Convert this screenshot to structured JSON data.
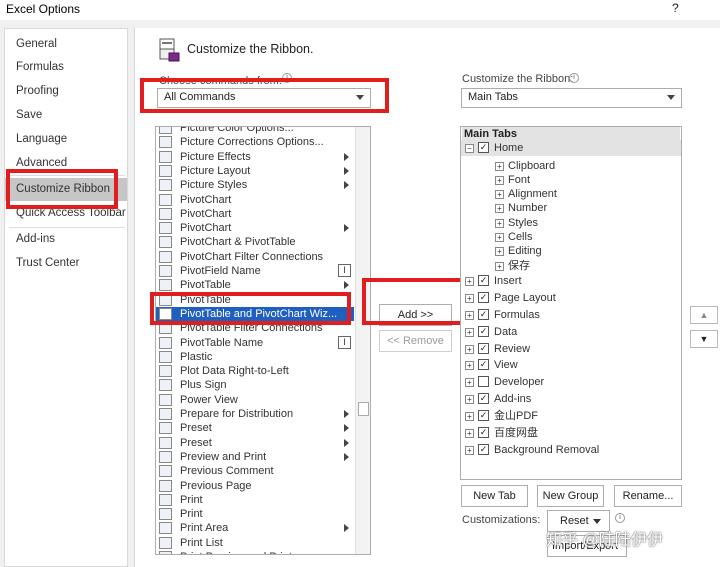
{
  "window": {
    "title": "Excel Options",
    "help": "?"
  },
  "nav": {
    "items": [
      "General",
      "Formulas",
      "Proofing",
      "Save",
      "Language",
      "Advanced",
      "Customize Ribbon",
      "Quick Access Toolbar",
      "Add-ins",
      "Trust Center"
    ],
    "selected": "Customize Ribbon"
  },
  "header": {
    "title": "Customize the Ribbon."
  },
  "left": {
    "choose_label": "Choose commands from:",
    "dropdown_value": "All Commands",
    "commands": [
      {
        "label": "Picture Color Options...",
        "icon": "picture-color-icon"
      },
      {
        "label": "Picture Corrections Options...",
        "icon": "picture-corrections-icon"
      },
      {
        "label": "Picture Effects",
        "icon": "picture-effects-icon",
        "submenu": true
      },
      {
        "label": "Picture Layout",
        "icon": "picture-layout-icon",
        "submenu": true
      },
      {
        "label": "Picture Styles",
        "icon": "picture-styles-icon",
        "submenu": true
      },
      {
        "label": "PivotChart",
        "icon": "pivotchart-icon"
      },
      {
        "label": "PivotChart",
        "icon": "pivotchart-icon"
      },
      {
        "label": "PivotChart",
        "icon": "pivotchart-icon",
        "submenu": true
      },
      {
        "label": "PivotChart & PivotTable",
        "icon": "pivotchart-pivottable-icon"
      },
      {
        "label": "PivotChart Filter Connections",
        "icon": "filter-connections-icon"
      },
      {
        "label": "PivotField Name",
        "icon": "field-name-icon",
        "ibeam": true
      },
      {
        "label": "PivotTable",
        "icon": "pivottable-icon",
        "submenu": true
      },
      {
        "label": "PivotTable",
        "icon": "pivottable-icon"
      },
      {
        "label": "PivotTable and PivotChart Wiz...",
        "icon": "pivot-wizard-icon",
        "selected": true
      },
      {
        "label": "PivotTable Filter Connections",
        "icon": "filter-connections-icon"
      },
      {
        "label": "PivotTable Name",
        "icon": "table-name-icon",
        "ibeam": true
      },
      {
        "label": "Plastic",
        "icon": "plastic-icon"
      },
      {
        "label": "Plot Data Right-to-Left",
        "icon": "checkmark-icon"
      },
      {
        "label": "Plus Sign",
        "icon": "plus-sign-icon"
      },
      {
        "label": "Power View",
        "icon": "power-view-icon"
      },
      {
        "label": "Prepare for Distribution",
        "icon": "prepare-icon",
        "submenu": true
      },
      {
        "label": "Preset",
        "icon": "preset-icon",
        "submenu": true
      },
      {
        "label": "Preset",
        "icon": "preset-icon",
        "submenu": true
      },
      {
        "label": "Preview and Print",
        "icon": "preview-print-icon",
        "submenu": true
      },
      {
        "label": "Previous Comment",
        "icon": "previous-comment-icon"
      },
      {
        "label": "Previous Page",
        "icon": "previous-page-icon"
      },
      {
        "label": "Print",
        "icon": "checkmark-icon"
      },
      {
        "label": "Print",
        "icon": "checkmark-icon"
      },
      {
        "label": "Print Area",
        "icon": "print-area-icon",
        "submenu": true
      },
      {
        "label": "Print List",
        "icon": "print-list-icon"
      },
      {
        "label": "Print Preview and Print",
        "icon": "print-preview-icon"
      }
    ]
  },
  "middle": {
    "add_label": "Add >>",
    "remove_label": "<< Remove"
  },
  "right": {
    "customize_label": "Customize the Ribbon:",
    "dropdown_value": "Main Tabs",
    "tree_header": "Main Tabs",
    "home": {
      "label": "Home",
      "checked": true,
      "groups": [
        "Clipboard",
        "Font",
        "Alignment",
        "Number",
        "Styles",
        "Cells",
        "Editing",
        "保存"
      ]
    },
    "tabs": [
      {
        "label": "Insert",
        "checked": true
      },
      {
        "label": "Page Layout",
        "checked": true
      },
      {
        "label": "Formulas",
        "checked": true
      },
      {
        "label": "Data",
        "checked": true
      },
      {
        "label": "Review",
        "checked": true
      },
      {
        "label": "View",
        "checked": true
      },
      {
        "label": "Developer",
        "checked": false
      },
      {
        "label": "Add-ins",
        "checked": true
      },
      {
        "label": "金山PDF",
        "checked": true
      },
      {
        "label": "百度网盘",
        "checked": true
      },
      {
        "label": "Background Removal",
        "checked": true
      }
    ],
    "new_tab": "New Tab",
    "new_group": "New Group",
    "rename": "Rename...",
    "customizations_label": "Customizations:",
    "reset": "Reset",
    "import_export": "Import/Export"
  },
  "watermark": "知乎 @陆陆伊伊",
  "colors": {
    "highlight": "#e01e1e",
    "selection": "#1f5fbf"
  }
}
